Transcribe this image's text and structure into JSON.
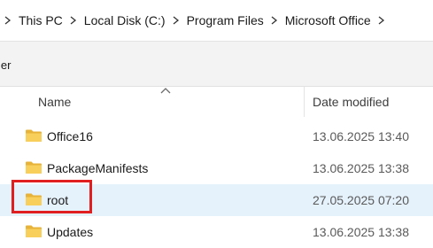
{
  "breadcrumb": {
    "items": [
      "This PC",
      "Local Disk (C:)",
      "Program Files",
      "Microsoft Office"
    ]
  },
  "toolbar": {
    "partial_text": "ler"
  },
  "columns": {
    "name": "Name",
    "date_modified": "Date modified",
    "sort": "ascending"
  },
  "files": [
    {
      "name": "Office16",
      "date": "13.06.2025 13:40",
      "icon": "folder-icon"
    },
    {
      "name": "PackageManifests",
      "date": "13.06.2025 13:38",
      "icon": "folder-icon"
    },
    {
      "name": "root",
      "date": "27.05.2025 07:20",
      "icon": "folder-icon",
      "selected": true,
      "highlighted": true
    },
    {
      "name": "Updates",
      "date": "13.06.2025 13:38",
      "icon": "folder-icon"
    }
  ],
  "colors": {
    "folder": "#f2c94c",
    "selection": "#e5f1fb",
    "highlight_border": "#e02020"
  }
}
